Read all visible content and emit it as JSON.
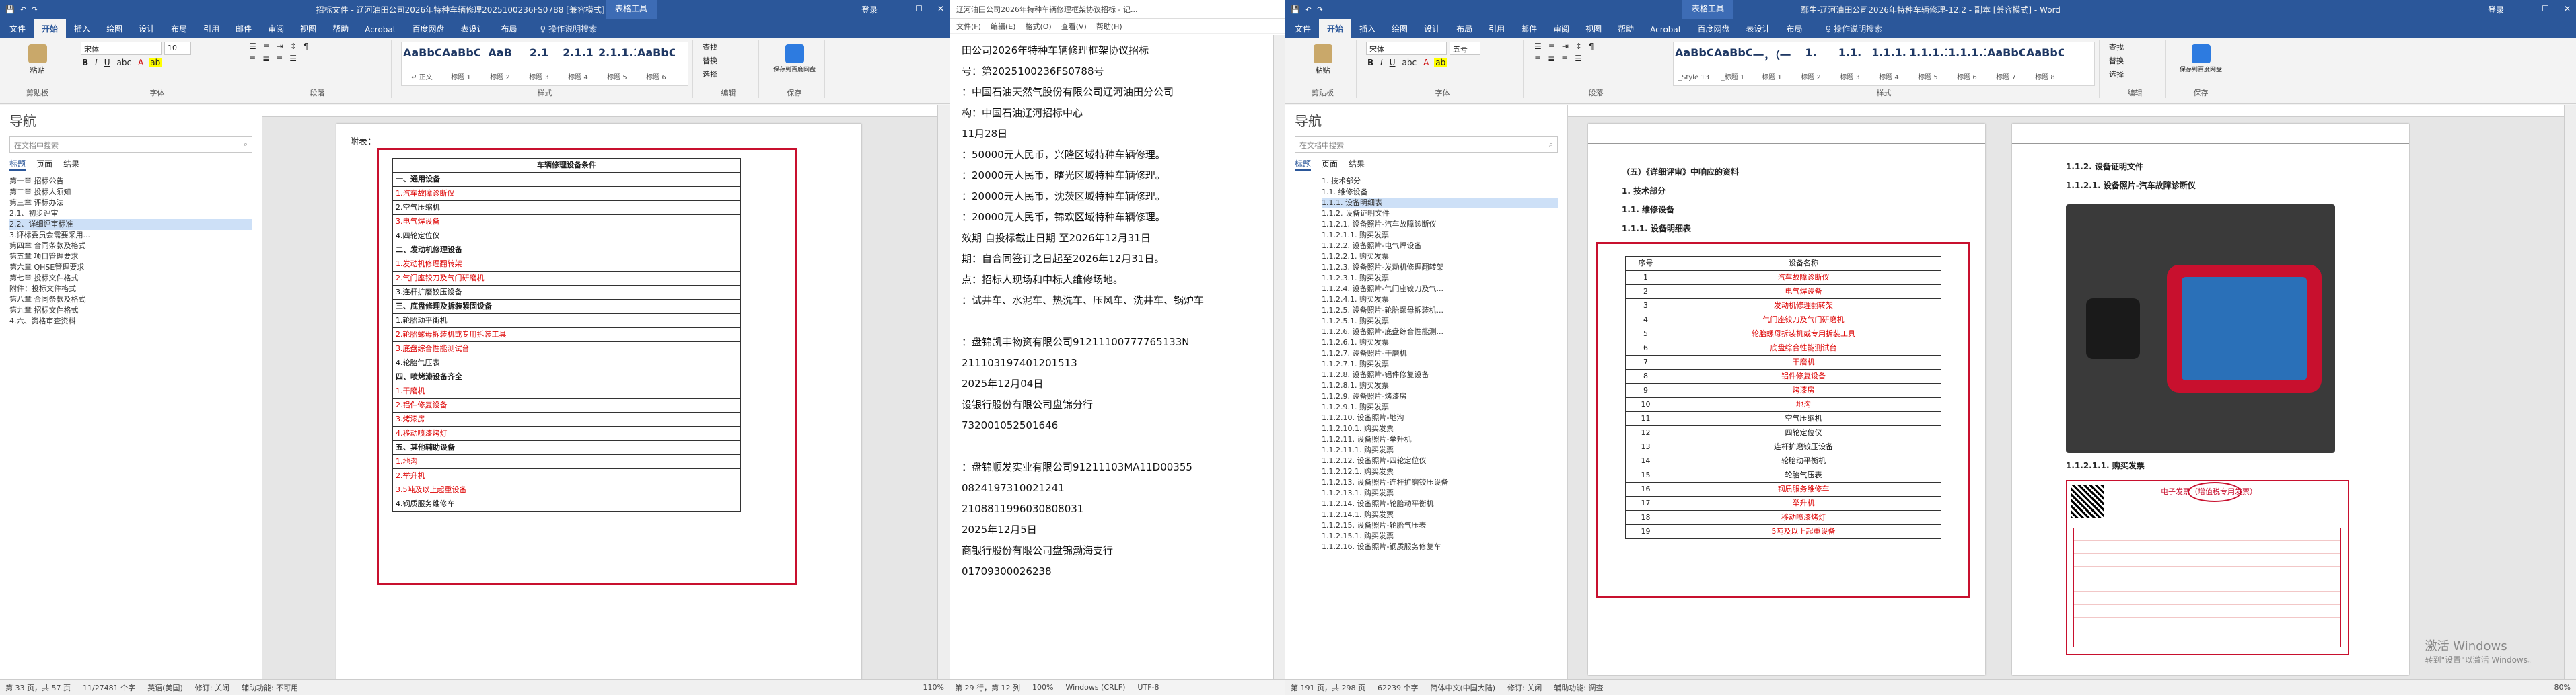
{
  "w1": {
    "title": "招标文件 - 辽河油田公司2026年特种车辆修理2025100236FS0788 [兼容模式] - Word",
    "ctx": "表格工具",
    "login": "登录",
    "tabs": [
      "文件",
      "开始",
      "插入",
      "绘图",
      "设计",
      "布局",
      "引用",
      "邮件",
      "审阅",
      "视图",
      "帮助",
      "Acrobat",
      "百度网盘",
      "表设计",
      "布局",
      "♀ 操作说明搜索"
    ],
    "font": "宋体",
    "size": "10",
    "styles": [
      {
        "p": "AaBbCcD",
        "n": "↵ 正文"
      },
      {
        "p": "AaBbC",
        "n": "标题 1"
      },
      {
        "p": "AaB",
        "n": "标题 2"
      },
      {
        "p": "2.1",
        "n": "标题 3"
      },
      {
        "p": "2.1.1",
        "n": "标题 4"
      },
      {
        "p": "2.1.1.1",
        "n": "标题 5"
      },
      {
        "p": "AaBbC",
        "n": "标题 6"
      }
    ],
    "groups": [
      "剪贴板",
      "字体",
      "段落",
      "样式",
      "编辑",
      "保存"
    ],
    "btns": [
      "查找",
      "替换",
      "选择",
      "保存到百度网盘",
      "粘贴"
    ],
    "nav": {
      "title": "导航",
      "search": "在文档中搜索",
      "tabs": [
        "标题",
        "页面",
        "结果"
      ],
      "items": [
        "第一章 招标公告",
        "第二章 投标人须知",
        "第三章 评标办法",
        "2.1、初步评审",
        "2.2、详细评审标准",
        "3.评标委员会需要采用...",
        "第四章 合同条款及格式",
        "第五章 项目管理要求",
        "第六章 QHSE管理要求",
        "第七章 投标文件格式",
        "附件：投标文件格式",
        "第八章 合同条款及格式",
        "第九章 招标文件格式",
        "4.六、资格审查资料"
      ]
    },
    "attach": "附表：",
    "table_title": "车辆修理设备条件",
    "rows": [
      [
        "一、通用设备",
        "b"
      ],
      [
        "1.汽车故障诊断仪",
        "r"
      ],
      [
        "2.空气压缩机",
        "k"
      ],
      [
        "3.电气焊设备",
        "r"
      ],
      [
        "4.四轮定位仪",
        "k"
      ],
      [
        "二、发动机修理设备",
        "b"
      ],
      [
        "1.发动机修理翻转架",
        "r"
      ],
      [
        "2.气门座铰刀及气门研磨机",
        "r"
      ],
      [
        "3.连杆扩磨铰压设备",
        "k"
      ],
      [
        "三、底盘修理及拆装紧固设备",
        "b"
      ],
      [
        "1.轮胎动平衡机",
        "k"
      ],
      [
        "2.轮胎螺母拆装机或专用拆装工具",
        "r"
      ],
      [
        "3.底盘综合性能测试台",
        "r"
      ],
      [
        "4.轮胎气压表",
        "k"
      ],
      [
        "四、喷烤漆设备齐全",
        "b"
      ],
      [
        "1.干磨机",
        "r"
      ],
      [
        "2.铝件修复设备",
        "r"
      ],
      [
        "3.烤漆房",
        "r"
      ],
      [
        "4.移动喷漆烤灯",
        "r"
      ],
      [
        "五、其他辅助设备",
        "b"
      ],
      [
        "1.地沟",
        "r"
      ],
      [
        "2.举升机",
        "r"
      ],
      [
        "3.5吨及以上起重设备",
        "r"
      ],
      [
        "4.钢质服务维修车",
        "k"
      ]
    ],
    "status": [
      "第 33 页，共 57 页",
      "11/27481 个字",
      "英语(美国)",
      "修订: 关闭",
      "辅助功能: 不可用"
    ],
    "zoom": "110%"
  },
  "w2": {
    "title": "辽河油田公司2026年特种车辆修理框架协议招标 - 记...",
    "menu": [
      "文件(F)",
      "编辑(E)",
      "格式(O)",
      "查看(V)",
      "帮助(H)"
    ],
    "lines": [
      "田公司2026年特种车辆修理框架协议招标",
      "号：第2025100236FS0788号",
      "：中国石油天然气股份有限公司辽河油田分公司",
      "构：中国石油辽河招标中心",
      "11月28日",
      "：50000元人民币，兴隆区域特种车辆修理。",
      "：20000元人民币，曙光区域特种车辆修理。",
      "：20000元人民币，沈茨区域特种车辆修理。",
      "：20000元人民币，锦欢区域特种车辆修理。",
      "效期  自投标截止日期 至2026年12月31日",
      "期：自合同签订之日起至2026年12月31日。",
      "点：招标人现场和中标人维修场地。",
      "：试井车、水泥车、热洗车、压风车、洗井车、锅炉车",
      "",
      "：盘锦凯丰物资有限公司91211100777765133N",
      "211103197401201513",
      "2025年12月04日",
      "设银行股份有限公司盘锦分行",
      "732001052501646",
      "",
      "：盘锦顺发实业有限公司91211103MA11D00355",
      "0824197310021241",
      "2108811996030808031",
      "2025年12月5日",
      "商银行股份有限公司盘锦渤海支行",
      "01709300026238"
    ],
    "status": [
      "第 29 行，第 12 列",
      "100%",
      "Windows (CRLF)",
      "UTF-8"
    ]
  },
  "w3": {
    "title": "鄢生-辽河油田公司2026年特种车辆修理-12.2 - 副本 [兼容模式] - Word",
    "ctx": "表格工具",
    "login": "登录",
    "tabs": [
      "文件",
      "开始",
      "插入",
      "绘图",
      "设计",
      "布局",
      "引用",
      "邮件",
      "审阅",
      "视图",
      "帮助",
      "Acrobat",
      "百度网盘",
      "表设计",
      "布局",
      "♀ 操作说明搜索"
    ],
    "font": "宋体",
    "size": "五号",
    "styles": [
      {
        "p": "AaBbCcI",
        "n": "_Style 13"
      },
      {
        "p": "AaBbC",
        "n": "_标题 1"
      },
      {
        "p": "一，（一）",
        "n": "标题 1"
      },
      {
        "p": "1.",
        "n": "标题 2"
      },
      {
        "p": "1.1.",
        "n": "标题 3"
      },
      {
        "p": "1.1.1.",
        "n": "标题 4"
      },
      {
        "p": "1.1.1.1.",
        "n": "标题 5"
      },
      {
        "p": "1.1.1.1.1",
        "n": "标题 6"
      },
      {
        "p": "AaBbC",
        "n": "标题 7"
      },
      {
        "p": "AaBbCc",
        "n": "标题 8"
      }
    ],
    "nav": {
      "title": "导航",
      "search": "在文档中搜索",
      "tabs": [
        "标题",
        "页面",
        "结果"
      ],
      "items": [
        "1. 技术部分",
        "1.1. 维修设备",
        "1.1.1. 设备明细表",
        "1.1.2. 设备证明文件",
        "1.1.2.1. 设备照片-汽车故障诊断仪",
        "1.1.2.1.1. 购买发票",
        "1.1.2.2. 设备照片-电气焊设备",
        "1.1.2.2.1. 购买发票",
        "1.1.2.3. 设备照片-发动机修理翻转架",
        "1.1.2.3.1. 购买发票",
        "1.1.2.4. 设备照片-气门座铰刀及气...",
        "1.1.2.4.1. 购买发票",
        "1.1.2.5. 设备照片-轮胎螺母拆装机...",
        "1.1.2.5.1. 购买发票",
        "1.1.2.6. 设备照片-底盘综合性能测...",
        "1.1.2.6.1. 购买发票",
        "1.1.2.7. 设备照片-干磨机",
        "1.1.2.7.1. 购买发票",
        "1.1.2.8. 设备照片-铝件修复设备",
        "1.1.2.8.1. 购买发票",
        "1.1.2.9. 设备照片-烤漆房",
        "1.1.2.9.1. 购买发票",
        "1.1.2.10. 设备照片-地沟",
        "1.1.2.10.1. 购买发票",
        "1.1.2.11. 设备照片-举升机",
        "1.1.2.11.1. 购买发票",
        "1.1.2.12. 设备照片-四轮定位仪",
        "1.1.2.12.1. 购买发票",
        "1.1.2.13. 设备照片-连杆扩磨铰压设备",
        "1.1.2.13.1. 购买发票",
        "1.1.2.14. 设备照片-轮胎动平衡机",
        "1.1.2.14.1. 购买发票",
        "1.1.2.15. 设备照片-轮胎气压表",
        "1.1.2.15.1. 购买发票",
        "1.1.2.16. 设备照片-钢质服务修复车"
      ]
    },
    "p1": {
      "head": "（五）《详细评审》中响应的资料",
      "l1": "1. 技术部分",
      "l2": "1.1. 维修设备",
      "l3": "1.1.1. 设备明细表",
      "th": [
        "序号",
        "设备名称"
      ],
      "rows": [
        [
          "1",
          "汽车故障诊断仪",
          "r"
        ],
        [
          "2",
          "电气焊设备",
          "r"
        ],
        [
          "3",
          "发动机修理翻转架",
          "r"
        ],
        [
          "4",
          "气门座铰刀及气门研磨机",
          "r"
        ],
        [
          "5",
          "轮胎螺母拆装机或专用拆装工具",
          "r"
        ],
        [
          "6",
          "底盘综合性能测试台",
          "r"
        ],
        [
          "7",
          "干磨机",
          "r"
        ],
        [
          "8",
          "铝件修复设备",
          "r"
        ],
        [
          "9",
          "烤漆房",
          "r"
        ],
        [
          "10",
          "地沟",
          "r"
        ],
        [
          "11",
          "空气压缩机",
          "k"
        ],
        [
          "12",
          "四轮定位仪",
          "k"
        ],
        [
          "13",
          "连杆扩磨铰压设备",
          "k"
        ],
        [
          "14",
          "轮胎动平衡机",
          "k"
        ],
        [
          "15",
          "轮胎气压表",
          "k"
        ],
        [
          "16",
          "钢质服务维修车",
          "r"
        ],
        [
          "17",
          "举升机",
          "r"
        ],
        [
          "18",
          "移动喷漆烤灯",
          "r"
        ],
        [
          "19",
          "5吨及以上起重设备",
          "r"
        ]
      ]
    },
    "p2": {
      "l1": "1.1.2. 设备证明文件",
      "l2": "1.1.2.1. 设备照片-汽车故障诊断仪",
      "l3": "1.1.2.1.1. 购买发票",
      "inv": "电子发票（增值税专用发票）"
    },
    "watermark": [
      "激活 Windows",
      "转到\"设置\"以激活 Windows。"
    ],
    "status": [
      "第 191 页，共 298 页",
      "62239 个字",
      "简体中文(中国大陆)",
      "修订: 关闭",
      "辅助功能: 调查"
    ],
    "zoom": "80%"
  }
}
